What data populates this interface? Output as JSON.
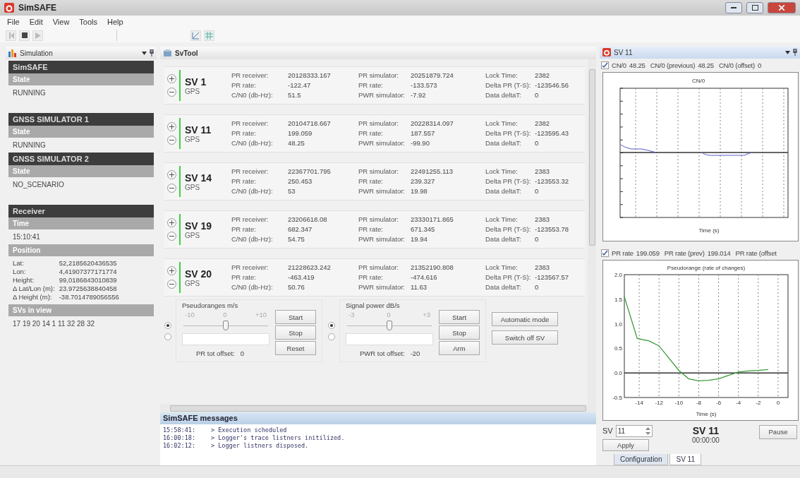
{
  "window": {
    "title": "SimSAFE"
  },
  "menu": [
    "File",
    "Edit",
    "View",
    "Tools",
    "Help"
  ],
  "simulation_panel": {
    "title": "Simulation",
    "sections": [
      {
        "heading": "SimSAFE",
        "fields": [
          {
            "label": "State",
            "kind": "text",
            "value": "RUNNING"
          }
        ]
      },
      {
        "heading": "GNSS SIMULATOR 1",
        "fields": [
          {
            "label": "State",
            "kind": "text",
            "value": "RUNNING"
          }
        ]
      },
      {
        "heading": "GNSS SIMULATOR 2",
        "fields": [
          {
            "label": "State",
            "kind": "text",
            "value": "NO_SCENARIO"
          }
        ]
      },
      {
        "heading": "Receiver",
        "fields": [
          {
            "label": "Time",
            "kind": "text",
            "value": "15:10:41"
          },
          {
            "label": "Position",
            "kind": "pairs",
            "pairs": [
              {
                "label": "Lat:",
                "value": "52,2185620436535"
              },
              {
                "label": "Lon:",
                "value": "4,41907377171774"
              },
              {
                "label": "Height:",
                "value": "99,0186843010839"
              },
              {
                "label": "Δ Lat/Lon (m):",
                "value": "23.9725638840458"
              },
              {
                "label": "Δ Height (m):",
                "value": "-38.7014789056556"
              }
            ]
          },
          {
            "label": "SVs in view",
            "kind": "text",
            "value": "17 19 20 14 1 11 32 28 32"
          }
        ]
      }
    ]
  },
  "sv_tool": {
    "title": "SvTool",
    "satellites": [
      {
        "name": "SV 1",
        "system": "GPS",
        "groups": [
          [
            {
              "label": "PR receiver:",
              "value": "20128333.167"
            },
            {
              "label": "PR rate:",
              "value": "-122.47"
            },
            {
              "label": "C/N0 (db-Hz):",
              "value": "51.5"
            }
          ],
          [
            {
              "label": "PR simulator:",
              "value": "20251879.724"
            },
            {
              "label": "PR rate:",
              "value": "-133.573"
            },
            {
              "label": "PWR simulator:",
              "value": "-7.92"
            }
          ],
          [
            {
              "label": "Lock Time:",
              "value": "2382"
            },
            {
              "label": "Delta PR (T-S):",
              "value": "-123546.56"
            },
            {
              "label": "Data deltaT:",
              "value": "0"
            }
          ]
        ]
      },
      {
        "name": "SV 11",
        "system": "GPS",
        "groups": [
          [
            {
              "label": "PR receiver:",
              "value": "20104718.667"
            },
            {
              "label": "PR rate:",
              "value": "199.059"
            },
            {
              "label": "C/N0 (db-Hz):",
              "value": "48.25"
            }
          ],
          [
            {
              "label": "PR simulator:",
              "value": "20228314.097"
            },
            {
              "label": "PR rate:",
              "value": "187.557"
            },
            {
              "label": "PWR simulator:",
              "value": "-99.90"
            }
          ],
          [
            {
              "label": "Lock Time:",
              "value": "2382"
            },
            {
              "label": "Delta PR (T-S):",
              "value": "-123595.43"
            },
            {
              "label": "Data deltaT:",
              "value": "0"
            }
          ]
        ]
      },
      {
        "name": "SV 14",
        "system": "GPS",
        "groups": [
          [
            {
              "label": "PR receiver:",
              "value": "22367701.795"
            },
            {
              "label": "PR rate:",
              "value": "250.453"
            },
            {
              "label": "C/N0 (db-Hz):",
              "value": "53"
            }
          ],
          [
            {
              "label": "PR simulator:",
              "value": "22491255.113"
            },
            {
              "label": "PR rate:",
              "value": "239.327"
            },
            {
              "label": "PWR simulator:",
              "value": "19.98"
            }
          ],
          [
            {
              "label": "Lock Time:",
              "value": "2383"
            },
            {
              "label": "Delta PR (T-S):",
              "value": "-123553.32"
            },
            {
              "label": "Data deltaT:",
              "value": "0"
            }
          ]
        ]
      },
      {
        "name": "SV 19",
        "system": "GPS",
        "groups": [
          [
            {
              "label": "PR receiver:",
              "value": "23206618.08"
            },
            {
              "label": "PR rate:",
              "value": "682.347"
            },
            {
              "label": "C/N0 (db-Hz):",
              "value": "54.75"
            }
          ],
          [
            {
              "label": "PR simulator:",
              "value": "23330171.865"
            },
            {
              "label": "PR rate:",
              "value": "671.345"
            },
            {
              "label": "PWR simulator:",
              "value": "19.94"
            }
          ],
          [
            {
              "label": "Lock Time:",
              "value": "2383"
            },
            {
              "label": "Delta PR (T-S):",
              "value": "-123553.78"
            },
            {
              "label": "Data deltaT:",
              "value": "0"
            }
          ]
        ]
      },
      {
        "name": "SV 20",
        "system": "GPS",
        "groups": [
          [
            {
              "label": "PR receiver:",
              "value": "21228623.242"
            },
            {
              "label": "PR rate:",
              "value": "-463.419"
            },
            {
              "label": "C/N0 (db-Hz):",
              "value": "50.76"
            }
          ],
          [
            {
              "label": "PR simulator:",
              "value": "21352190.808"
            },
            {
              "label": "PR rate:",
              "value": "-474.616"
            },
            {
              "label": "PWR simulator:",
              "value": "11.63"
            }
          ],
          [
            {
              "label": "Lock Time:",
              "value": "2383"
            },
            {
              "label": "Delta PR (T-S):",
              "value": "-123567.57"
            },
            {
              "label": "Data deltaT:",
              "value": "0"
            }
          ]
        ]
      }
    ],
    "controls": [
      {
        "title": "Pseudoranges m/s",
        "scale": [
          "-10",
          "0",
          "+10"
        ],
        "level": 0.5,
        "radios": [
          {
            "selected": true
          },
          {
            "selected": false
          }
        ],
        "buttons": [
          "Start",
          "Stop",
          "Reset"
        ],
        "offset_label": "PR tot offset:",
        "offset_value": "0"
      },
      {
        "title": "Signal power dB/s",
        "scale": [
          "-3",
          "0",
          "+3"
        ],
        "level": 0.5,
        "radios": [
          {
            "selected": true
          },
          {
            "selected": false
          }
        ],
        "buttons": [
          "Start",
          "Stop",
          "Arm"
        ],
        "offset_label": "PWR tot offset:",
        "offset_value": "-20"
      }
    ],
    "mode_buttons": [
      "Automatic mode",
      "Switch off SV"
    ]
  },
  "messages": {
    "title": "SimSAFE messages",
    "entries": [
      {
        "time": "15:58:41:",
        "text": "> Execution scheduled"
      },
      {
        "time": "16:00:18:",
        "text": "> Logger's trace listners initilized."
      },
      {
        "time": "16:02:12:",
        "text": "> Logger listners disposed."
      }
    ]
  },
  "sv_panel": {
    "title": "SV 11",
    "cn0_row": {
      "checked": true,
      "items": [
        "CN/0",
        "48.25",
        "CN/0 (previous)",
        "48.25",
        "CN/0 (offset)",
        "0"
      ]
    },
    "cn0_chart": {
      "title": "CN/0",
      "xlabel": "Time (s)"
    },
    "pr_row": {
      "checked": true,
      "items": [
        "PR rate",
        "199.059",
        "PR rate (prev)",
        "199.014",
        "PR rate (offset"
      ]
    },
    "pr_chart": {
      "chart_data": {
        "type": "line",
        "title": "Pseudorange (rate of changes)",
        "xlabel": "Time (s)",
        "grid": true,
        "xlim": [
          -15.5,
          1
        ],
        "ylim": [
          -0.5,
          2
        ],
        "xticks": [
          -14,
          -12,
          -10,
          -8,
          -6,
          -4,
          -2,
          0
        ],
        "yticks": [
          {
            "value": -0.5,
            "label": "-0.5"
          },
          {
            "value": 0,
            "label": "0.0"
          },
          {
            "value": 0.5,
            "label": "0.5"
          },
          {
            "value": 1,
            "label": "1.0"
          },
          {
            "value": 1.5,
            "label": "1.5"
          },
          {
            "value": 2,
            "label": "2.0"
          }
        ],
        "x": [
          -15.5,
          -14.2,
          -13,
          -12,
          -11,
          -10,
          -9,
          -8,
          -7,
          -6,
          -5,
          -4,
          -3,
          -2,
          -1
        ],
        "series": [
          {
            "color": "#3a9a3a",
            "values": [
              1.55,
              0.7,
              0.65,
              0.55,
              0.3,
              0.05,
              -0.12,
              -0.16,
              -0.15,
              -0.12,
              -0.05,
              0.02,
              0.04,
              0.05,
              0.07
            ]
          }
        ]
      }
    },
    "sv_field": {
      "label": "SV",
      "value": "11"
    },
    "apply": "Apply",
    "current_sv": "SV 11",
    "clock": "00:00:00",
    "pause": "Pause",
    "tabs": [
      {
        "label": "Configuration",
        "selected": false
      },
      {
        "label": "SV 11",
        "selected": true
      }
    ]
  }
}
